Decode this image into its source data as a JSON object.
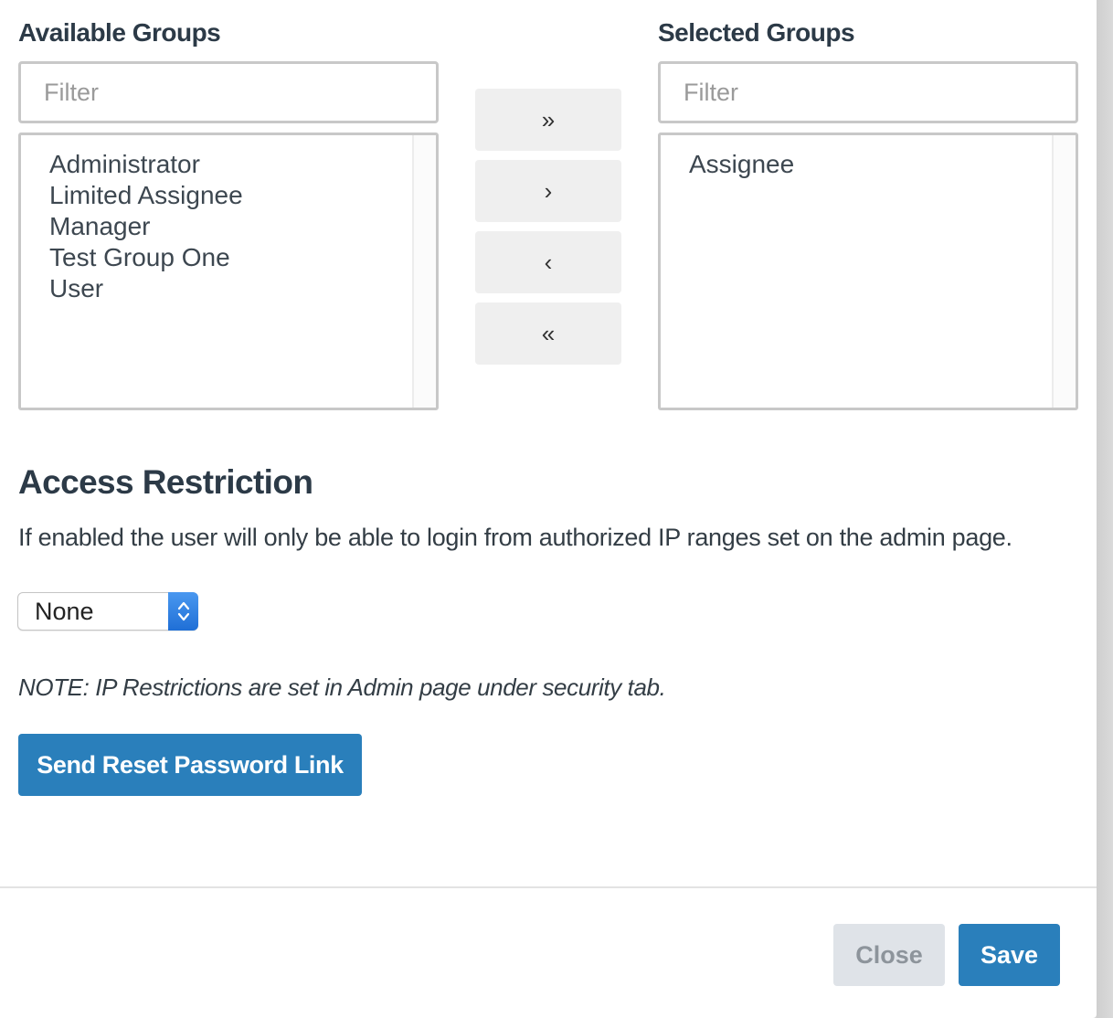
{
  "available_groups": {
    "title": "Available Groups",
    "filter_placeholder": "Filter",
    "items": [
      "Administrator",
      "Limited Assignee",
      "Manager",
      "Test Group One",
      "User"
    ]
  },
  "selected_groups": {
    "title": "Selected Groups",
    "filter_placeholder": "Filter",
    "items": [
      "Assignee"
    ]
  },
  "transfer_buttons": {
    "move_all_right": "»",
    "move_right": "›",
    "move_left": "‹",
    "move_all_left": "«"
  },
  "access_restriction": {
    "title": "Access Restriction",
    "description": "If enabled the user will only be able to login from authorized IP ranges set on the admin page.",
    "select_value": "None",
    "note": "NOTE: IP Restrictions are set in Admin page under security tab."
  },
  "actions": {
    "reset_password_label": "Send Reset Password Link",
    "close_label": "Close",
    "save_label": "Save"
  },
  "colors": {
    "primary": "#2a7fbb",
    "close_bg": "#dfe3e8",
    "select_accent": "#2f84e6"
  }
}
